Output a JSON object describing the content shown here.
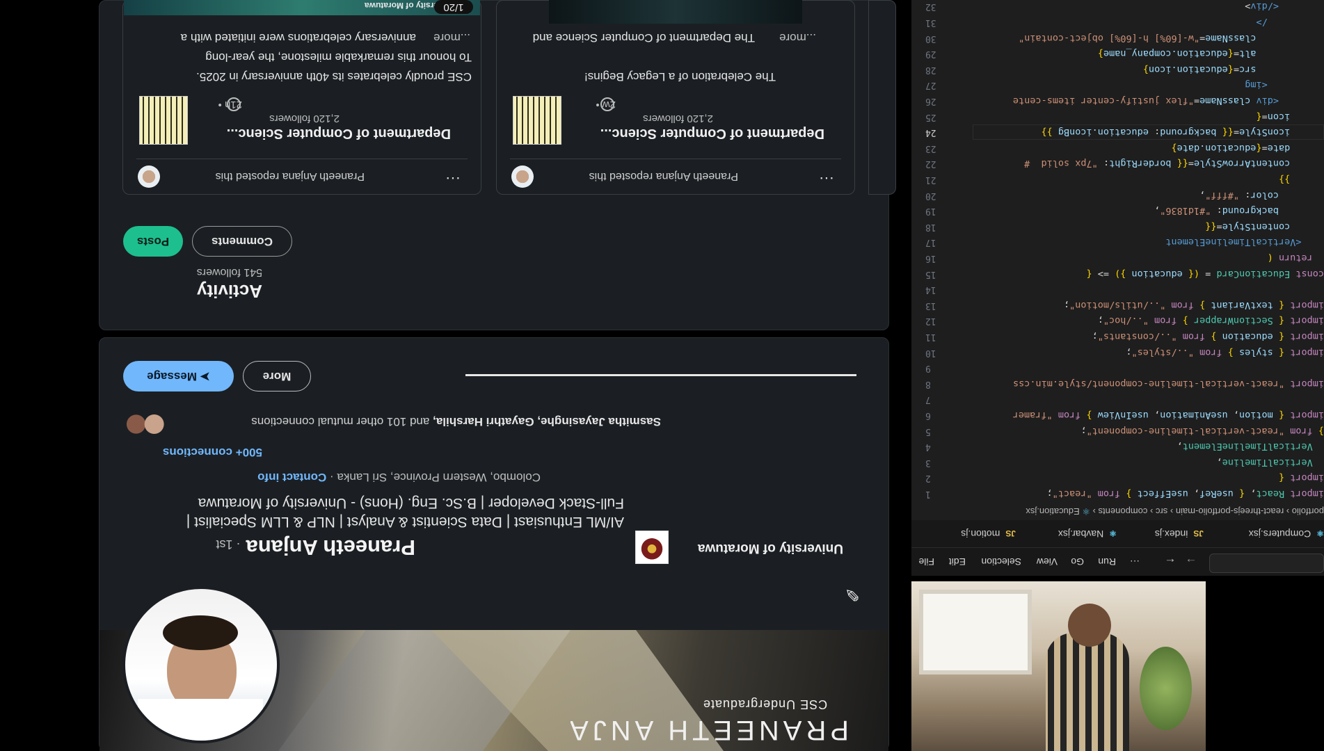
{
  "profile": {
    "banner_name": "PRANEETH ANJANA",
    "banner_subtitle": "CSE Undergraduate",
    "name": "Praneeth Anjana",
    "degree": "· 1st",
    "headline_1": "AI/ML Enthusiast | Data Scientist & Analyst | NLP & LLM Specialist |",
    "headline_2": "Full-Stack Developer | B.Sc. Eng. (Hons) - University of Moratuwa",
    "location": "Colombo, Western Province, Sri Lanka ·",
    "contact_info": "Contact info",
    "connections": "500+ connections",
    "mutual_names": "Sasmitha Jayasinghe, Gayathri Harshila,",
    "mutual_rest": "and 101 other mutual connections",
    "company": "University of Moratuwa",
    "message_btn": "Message",
    "more_btn": "More"
  },
  "activity": {
    "title": "Activity",
    "followers": "541 followers",
    "tab_posts": "Posts",
    "tab_comments": "Comments",
    "posts": [
      {
        "reposted": "Praneeth Anjana reposted this",
        "org": "Department of Computer Scienc...",
        "followers": "2,120 followers",
        "time": "21h •",
        "text_1": "CSE proudly celebrates its 40th anniversary in 2025.",
        "text_2": "To honour this remarkable milestone, the year-long",
        "text_3": "anniversary celebrations were initiated with a",
        "more": "...more",
        "image_text": "University of Moratuwa",
        "badge": "1/20"
      },
      {
        "reposted": "Praneeth Anjana reposted this",
        "org": "Department of Computer Scienc...",
        "followers": "2,120 followers",
        "time": "2w •",
        "text_1": "The Celebration of a Legacy Begins!",
        "text_2": "The Department of Computer Science and",
        "text_3": "",
        "more": "...more"
      }
    ]
  },
  "vscode": {
    "menu": [
      "File",
      "Edit",
      "Selection",
      "View",
      "Go",
      "Run",
      "···"
    ],
    "tabs": [
      {
        "label": "motion.js",
        "icon": "JS"
      },
      {
        "label": "Navbar.jsx",
        "icon": "⚛"
      },
      {
        "label": "index.js",
        "icon": "JS"
      },
      {
        "label": "Computers.jsx",
        "icon": "⚛"
      }
    ],
    "breadcrumb": [
      "portfolio",
      "react-threejs-portfolio-main",
      "src",
      "components",
      "Education.jsx"
    ],
    "lines": [
      {
        "n": "1",
        "code": "import React, { useRef, useEffect } from \"react\";"
      },
      {
        "n": "2",
        "code": "import {"
      },
      {
        "n": "3",
        "code": "  VerticalTimeline,"
      },
      {
        "n": "4",
        "code": "  VerticalTimelineElement,"
      },
      {
        "n": "5",
        "code": "} from \"react-vertical-timeline-component\";"
      },
      {
        "n": "6",
        "code": "import { motion, useAnimation, useInView } from \"framer"
      },
      {
        "n": "7",
        "code": ""
      },
      {
        "n": "8",
        "code": "import \"react-vertical-timeline-component/style.min.css"
      },
      {
        "n": "9",
        "code": ""
      },
      {
        "n": "10",
        "code": "import { styles } from \"../styles\";"
      },
      {
        "n": "11",
        "code": "import { education } from \"../constants\";"
      },
      {
        "n": "12",
        "code": "import { SectionWrapper } from \"../hoc\";"
      },
      {
        "n": "13",
        "code": "import { textVariant } from \"../utils/motion\";"
      },
      {
        "n": "14",
        "code": ""
      },
      {
        "n": "15",
        "code": "const EducationCard = ({ education }) => {"
      },
      {
        "n": "16",
        "code": "  return ("
      },
      {
        "n": "17",
        "code": "    <VerticalTimelineElement"
      },
      {
        "n": "18",
        "code": "      contentStyle={{"
      },
      {
        "n": "19",
        "code": "        background: \"#1d1836\","
      },
      {
        "n": "20",
        "code": "        color: \"#fff\","
      },
      {
        "n": "21",
        "code": "      }}"
      },
      {
        "n": "22",
        "code": "      contentArrowStyle={{ borderRight: \"7px solid  #"
      },
      {
        "n": "23",
        "code": "      date={education.date}"
      },
      {
        "n": "24",
        "code": "      iconStyle={{ background: education.iconBg }}"
      },
      {
        "n": "25",
        "code": "      icon={"
      },
      {
        "n": "26",
        "code": "        <div className=\"flex justify-center items-cente"
      },
      {
        "n": "27",
        "code": "          <img"
      },
      {
        "n": "28",
        "code": "            src={education.icon}"
      },
      {
        "n": "29",
        "code": "            alt={education.company_name}"
      },
      {
        "n": "30",
        "code": "            className=\"w-[60%] h-[60%] object-contain\""
      },
      {
        "n": "31",
        "code": "          />"
      },
      {
        "n": "32",
        "code": "        </div>"
      }
    ]
  }
}
